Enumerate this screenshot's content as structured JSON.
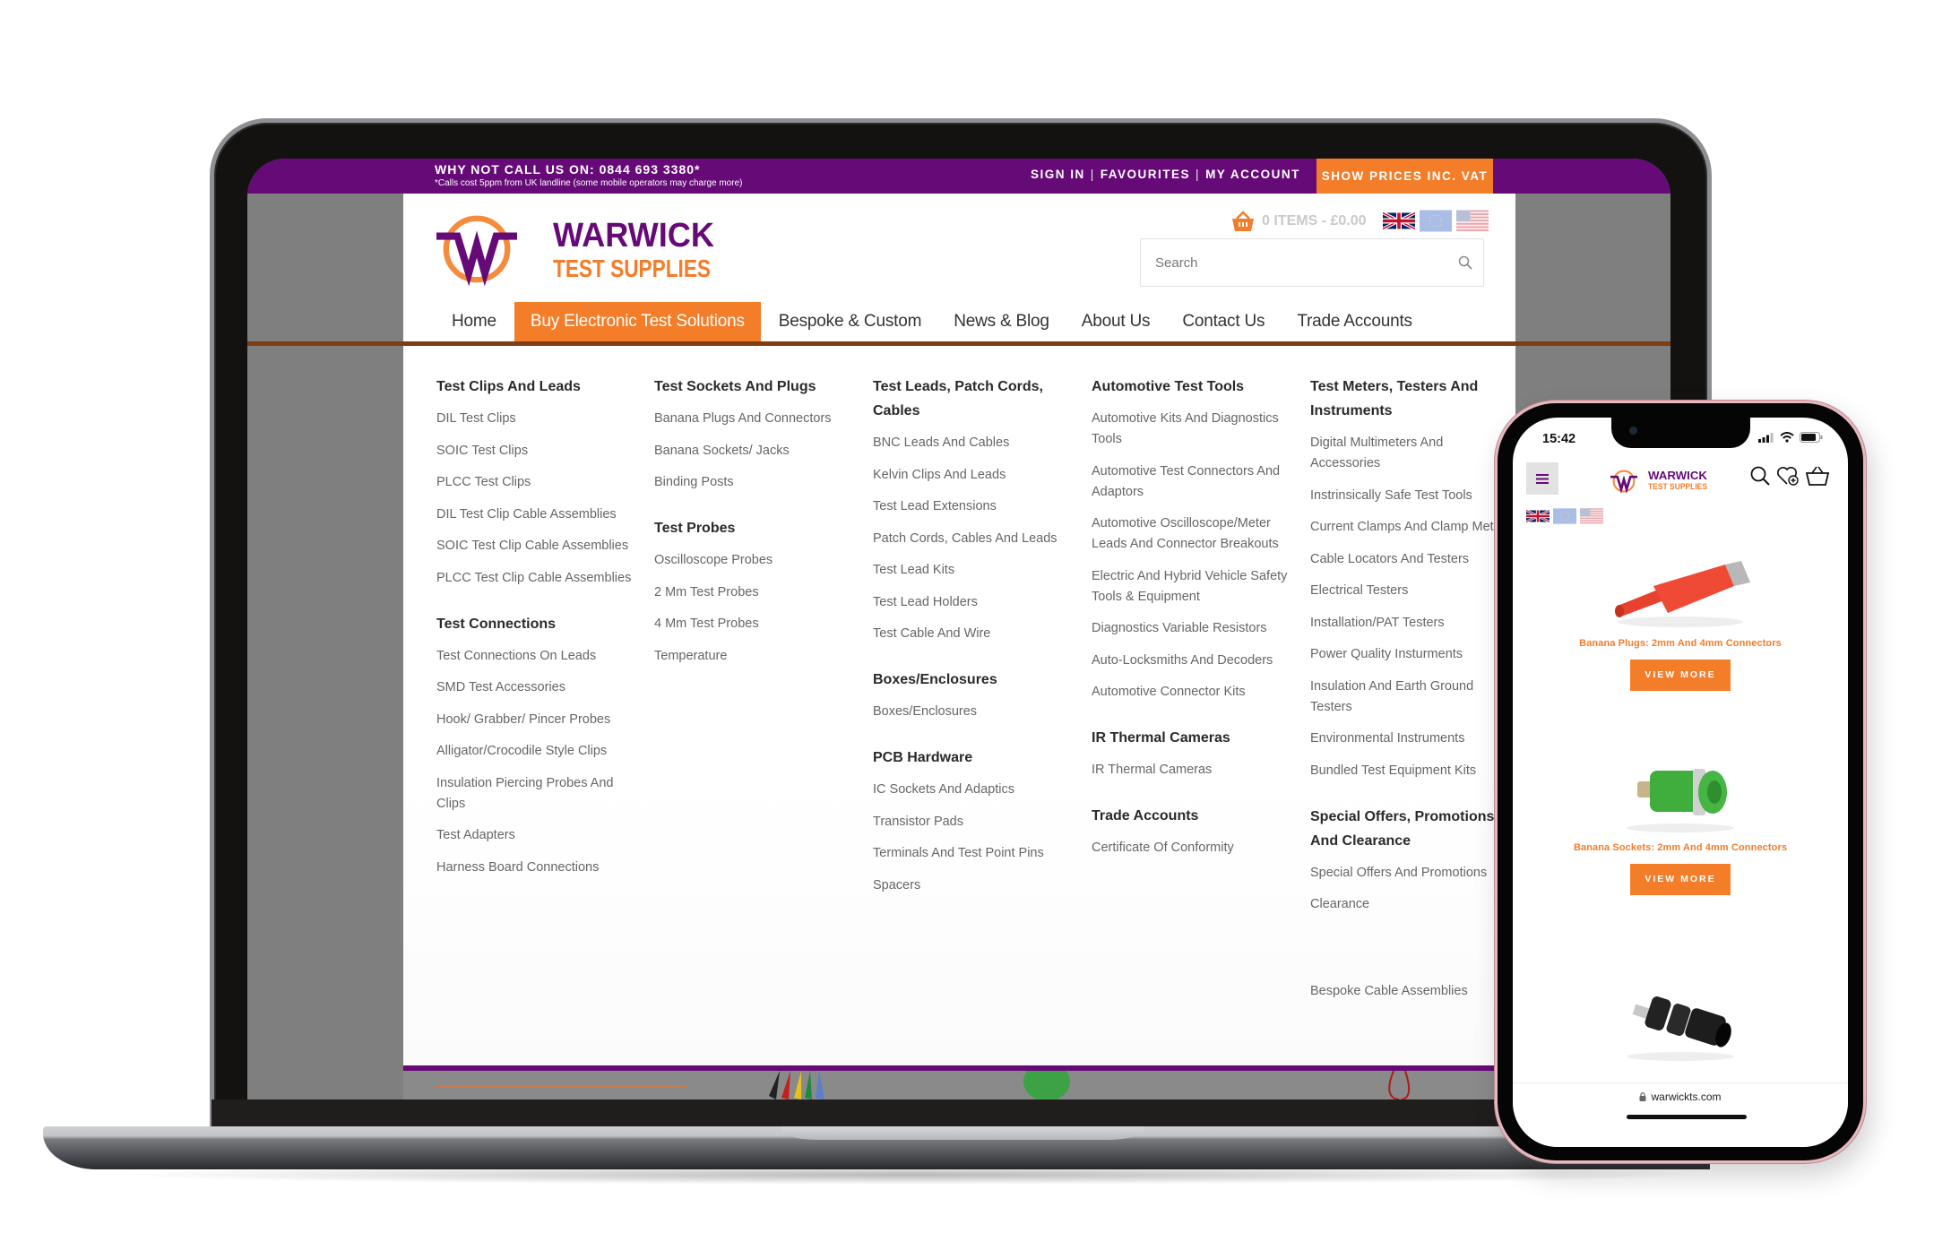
{
  "laptop": {
    "topbar": {
      "call_text": "WHY NOT CALL US ON: 0844 693 3380*",
      "call_note": "*Calls cost 5ppm from UK landline (some mobile operators may charge more)",
      "links": [
        "SIGN IN",
        "FAVOURITES",
        "MY ACCOUNT"
      ],
      "separator": "|",
      "vat_button": "SHOW PRICES INC. VAT"
    },
    "logo": {
      "line1": "WARWICK",
      "line2": "TEST SUPPLIES"
    },
    "cart": {
      "summary": "0 ITEMS - £0.00"
    },
    "flags": [
      "uk-flag",
      "eu-flag",
      "us-flag"
    ],
    "search": {
      "placeholder": "Search",
      "value": ""
    },
    "nav": [
      {
        "label": "Home",
        "active": false
      },
      {
        "label": "Buy Electronic Test Solutions",
        "active": true
      },
      {
        "label": "Bespoke & Custom",
        "active": false
      },
      {
        "label": "News & Blog",
        "active": false
      },
      {
        "label": "About Us",
        "active": false
      },
      {
        "label": "Contact Us",
        "active": false
      },
      {
        "label": "Trade Accounts",
        "active": false
      }
    ],
    "mega_menu": [
      {
        "groups": [
          {
            "heading": "Test Clips And Leads",
            "items": [
              "DIL Test Clips",
              "SOIC Test Clips",
              "PLCC Test Clips",
              "DIL Test Clip Cable Assemblies",
              "SOIC Test Clip Cable Assemblies",
              "PLCC Test Clip Cable Assemblies"
            ]
          },
          {
            "heading": "Test Connections",
            "items": [
              "Test Connections On Leads",
              "SMD Test Accessories",
              "Hook/ Grabber/ Pincer Probes",
              "Alligator/Crocodile Style Clips",
              "Insulation Piercing Probes And Clips",
              "Test Adapters",
              "Harness Board Connections"
            ]
          }
        ]
      },
      {
        "groups": [
          {
            "heading": "Test Sockets And Plugs",
            "items": [
              "Banana Plugs And Connectors",
              "Banana Sockets/ Jacks",
              "Binding Posts"
            ]
          },
          {
            "heading": "Test Probes",
            "items": [
              "Oscilloscope Probes",
              "2 Mm Test Probes",
              "4 Mm Test Probes",
              "Temperature"
            ]
          }
        ]
      },
      {
        "groups": [
          {
            "heading": "Test Leads, Patch Cords, Cables",
            "items": [
              "BNC Leads And Cables",
              "Kelvin Clips And Leads",
              "Test Lead Extensions",
              "Patch Cords, Cables And Leads",
              "Test Lead Kits",
              "Test Lead Holders",
              "Test Cable And Wire"
            ]
          },
          {
            "heading": "Boxes/Enclosures",
            "items": [
              "Boxes/Enclosures"
            ]
          },
          {
            "heading": "PCB Hardware",
            "items": [
              "IC Sockets And Adaptics",
              "Transistor Pads",
              "Terminals And Test Point Pins",
              "Spacers"
            ]
          }
        ]
      },
      {
        "groups": [
          {
            "heading": "Automotive Test Tools",
            "items": [
              "Automotive Kits And Diagnostics Tools",
              "Automotive Test Connectors And Adaptors",
              "Automotive Oscilloscope/Meter Leads And Connector Breakouts",
              "Electric And Hybrid Vehicle Safety Tools & Equipment",
              "Diagnostics Variable Resistors",
              "Auto-Locksmiths And Decoders",
              "Automotive Connector Kits"
            ]
          },
          {
            "heading": "IR Thermal Cameras",
            "items": [
              "IR Thermal Cameras"
            ]
          },
          {
            "heading": "Trade Accounts",
            "items": [
              "Certificate Of Conformity"
            ]
          }
        ]
      },
      {
        "groups": [
          {
            "heading": "Test Meters, Testers And Instruments",
            "items": [
              "Digital Multimeters And Accessories",
              "Instrinsically Safe Test Tools",
              "Current Clamps And Clamp Meters",
              "Cable Locators And Testers",
              "Electrical Testers",
              "Installation/PAT Testers",
              "Power Quality Insturments",
              "Insulation And Earth Ground Testers",
              "Environmental Instruments",
              "Bundled Test Equipment Kits"
            ]
          },
          {
            "heading": "Special Offers, Promotions And Clearance",
            "items": [
              "Special Offers And Promotions",
              "Clearance"
            ]
          },
          {
            "heading": "",
            "items": [
              "Bespoke Cable Assemblies"
            ]
          }
        ]
      }
    ]
  },
  "phone": {
    "status": {
      "time": "15:42"
    },
    "logo": {
      "line1": "WARWICK",
      "line2": "TEST SUPPLIES"
    },
    "flags": [
      "uk-flag",
      "eu-flag",
      "us-flag"
    ],
    "products": [
      {
        "title": "Banana Plugs: 2mm And 4mm Connectors",
        "button": "VIEW MORE",
        "image": "red-banana-plug"
      },
      {
        "title": "Banana Sockets: 2mm And 4mm Connectors",
        "button": "VIEW MORE",
        "image": "green-banana-socket"
      },
      {
        "title": "",
        "button": "",
        "image": "black-binding-post"
      }
    ],
    "url": "warwickts.com"
  },
  "colors": {
    "purple": "#660a78",
    "orange": "#f47d2a",
    "nav_rule": "#7e3d12"
  }
}
